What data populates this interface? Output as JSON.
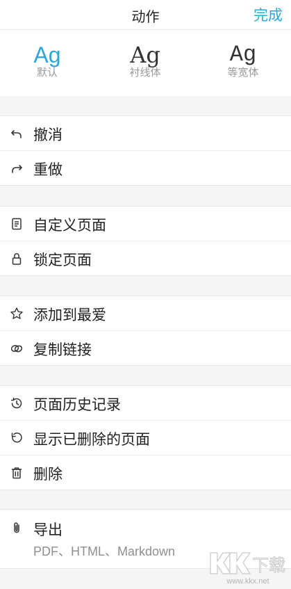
{
  "header": {
    "title": "动作",
    "done_label": "完成"
  },
  "fonts": {
    "options": [
      {
        "sample": "Ag",
        "label": "默认",
        "selected": true
      },
      {
        "sample": "Ag",
        "label": "衬线体",
        "selected": false
      },
      {
        "sample": "Ag",
        "label": "等宽体",
        "selected": false
      }
    ]
  },
  "sections": {
    "history": {
      "undo": {
        "label": "撤消",
        "icon": "undo-icon"
      },
      "redo": {
        "label": "重做",
        "icon": "redo-icon"
      }
    },
    "page": {
      "customize": {
        "label": "自定义页面",
        "icon": "page-icon"
      },
      "lock": {
        "label": "锁定页面",
        "icon": "lock-icon"
      }
    },
    "share": {
      "favorite": {
        "label": "添加到最爱",
        "icon": "star-icon"
      },
      "copy_link": {
        "label": "复制链接",
        "icon": "link-icon"
      }
    },
    "manage": {
      "page_history": {
        "label": "页面历史记录",
        "icon": "history-icon"
      },
      "show_deleted": {
        "label": "显示已删除的页面",
        "icon": "restore-icon"
      },
      "delete": {
        "label": "删除",
        "icon": "trash-icon"
      }
    },
    "export": {
      "export": {
        "label": "导出",
        "sublabel": "PDF、HTML、Markdown",
        "icon": "paperclip-icon"
      }
    }
  },
  "watermark": {
    "brand": "KK下载",
    "url": "www.kkx.net"
  },
  "colors": {
    "accent": "#2ba7d9",
    "background": "#f5f5f5",
    "surface": "#ffffff",
    "text": "#222222",
    "muted": "#8f8f8f"
  }
}
